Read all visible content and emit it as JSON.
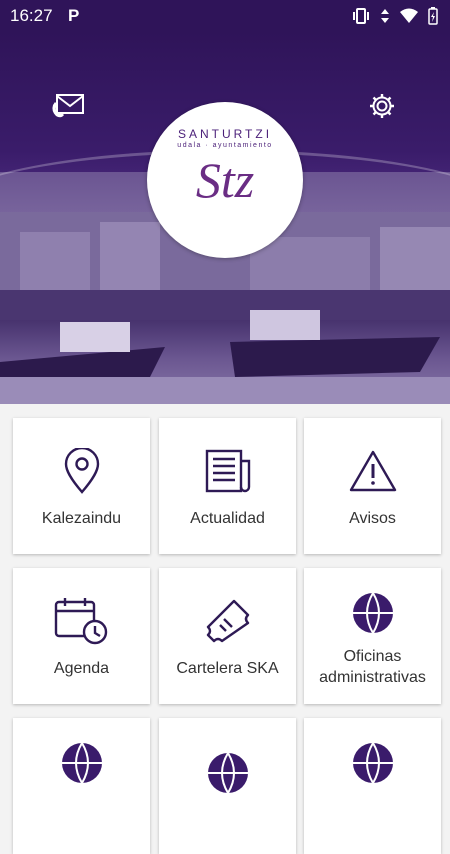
{
  "status": {
    "time": "16:27",
    "notification_icon": "P"
  },
  "logo": {
    "line1": "SANTURTZI",
    "line2": "udala · ayuntamiento",
    "line3": "Stz"
  },
  "colors": {
    "primary": "#3a1b6b",
    "icon": "#2e1a55"
  },
  "header": {
    "left_icon": "mail-phone-icon",
    "right_icon": "gear-icon"
  },
  "tiles": [
    {
      "label": "Kalezaindu",
      "icon": "location-pin-icon"
    },
    {
      "label": "Actualidad",
      "icon": "newspaper-icon"
    },
    {
      "label": "Avisos",
      "icon": "warning-icon"
    },
    {
      "label": "Agenda",
      "icon": "calendar-clock-icon"
    },
    {
      "label": "Cartelera SKA",
      "icon": "ticket-icon"
    },
    {
      "label": "Oficinas administrativas",
      "icon": "globe-icon"
    },
    {
      "label": "",
      "icon": "globe-icon"
    },
    {
      "label": "",
      "icon": "globe-icon"
    },
    {
      "label": "",
      "icon": "globe-icon"
    }
  ]
}
